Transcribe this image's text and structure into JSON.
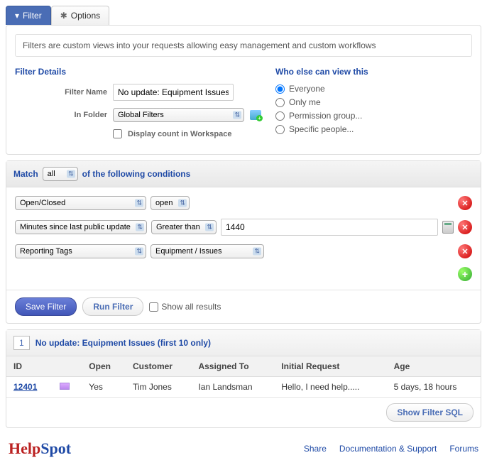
{
  "tabs": {
    "filter": "Filter",
    "options": "Options"
  },
  "infoBar": "Filters are custom views into your requests allowing easy management and custom workflows",
  "filterDetails": {
    "title": "Filter Details",
    "nameLabel": "Filter Name",
    "nameValue": "No update: Equipment Issues",
    "folderLabel": "In Folder",
    "folderValue": "Global Filters",
    "displayCountLabel": "Display count in Workspace"
  },
  "viewThis": {
    "title": "Who else can view this",
    "options": [
      "Everyone",
      "Only me",
      "Permission group...",
      "Specific people..."
    ],
    "selected": 0
  },
  "match": {
    "prefix": "Match",
    "mode": "all",
    "suffix": "of the following conditions"
  },
  "conditions": [
    {
      "field": "Open/Closed",
      "operator": "open"
    },
    {
      "field": "Minutes since last public update",
      "operator": "Greater than",
      "value": "1440",
      "hasCalc": true
    },
    {
      "field": "Reporting Tags",
      "operator": "Equipment / Issues"
    }
  ],
  "actions": {
    "save": "Save Filter",
    "run": "Run Filter",
    "showAll": "Show all results"
  },
  "results": {
    "page": "1",
    "title": "No update: Equipment Issues (first 10 only)",
    "columns": [
      "ID",
      "",
      "Open",
      "Customer",
      "Assigned To",
      "Initial Request",
      "Age"
    ],
    "rows": [
      {
        "id": "12401",
        "open": "Yes",
        "customer": "Tim Jones",
        "assignedTo": "Ian Landsman",
        "initial": "Hello, I need help.....",
        "age": "5 days, 18 hours"
      }
    ],
    "showSql": "Show Filter SQL"
  },
  "footer": {
    "logo1": "Help",
    "logo2": "Spot",
    "links": [
      "Share",
      "Documentation & Support",
      "Forums"
    ]
  }
}
